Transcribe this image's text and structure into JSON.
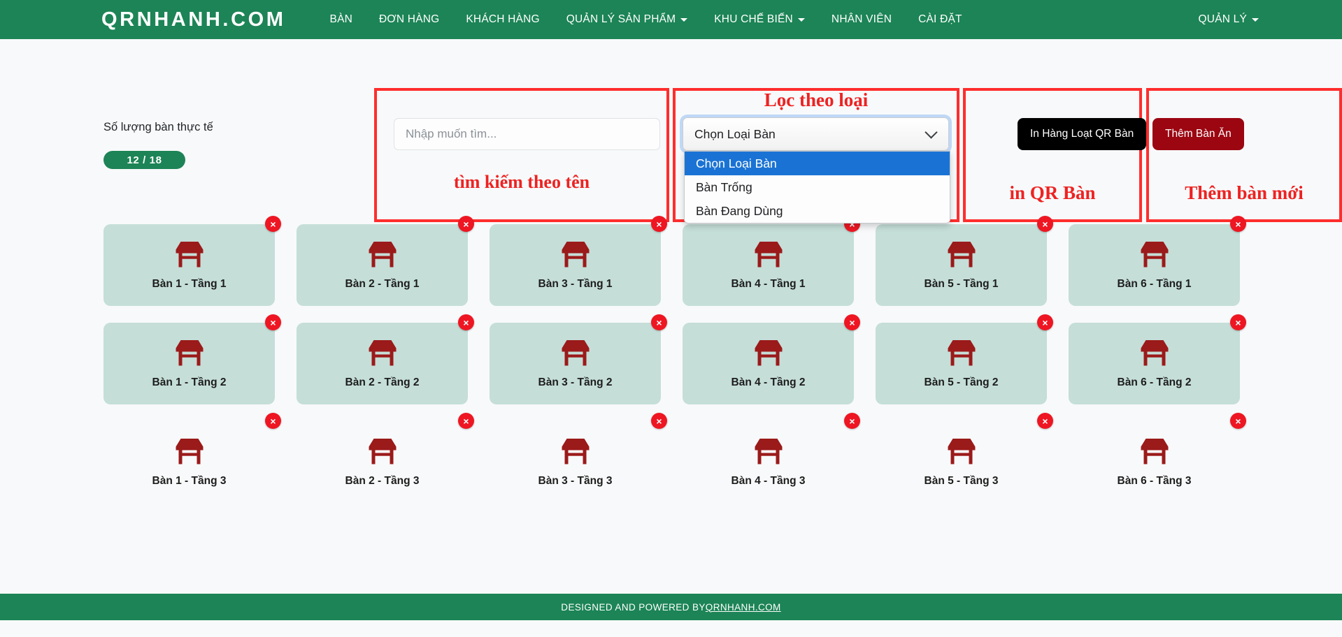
{
  "navbar": {
    "brand": "QRNHANH.COM",
    "links": [
      {
        "label": "BÀN",
        "caret": false
      },
      {
        "label": "ĐƠN HÀNG",
        "caret": false
      },
      {
        "label": "KHÁCH HÀNG",
        "caret": false
      },
      {
        "label": "QUẢN LÝ SẢN PHẨM",
        "caret": true
      },
      {
        "label": "KHU CHẾ BIẾN",
        "caret": true
      },
      {
        "label": "NHÂN VIÊN",
        "caret": false
      },
      {
        "label": "CÀI ĐẶT",
        "caret": false
      }
    ],
    "account": {
      "label": "QUẢN LÝ",
      "caret": true
    }
  },
  "summary": {
    "label": "Số lượng bàn thực tế",
    "badge": "12 / 18"
  },
  "search": {
    "placeholder": "Nhập muốn tìm...",
    "value": ""
  },
  "filter": {
    "selected": "Chọn Loại Bàn",
    "options": [
      "Chọn Loại Bàn",
      "Bàn Trống",
      "Bàn Đang Dùng"
    ]
  },
  "actions": {
    "print_qr": "In Hàng Loạt QR Bàn",
    "add_table": "Thêm Bàn Ăn"
  },
  "annotations": [
    {
      "label": "tìm kiếm theo tên"
    },
    {
      "label": "Lọc theo loại"
    },
    {
      "label": "in QR Bàn"
    },
    {
      "label": "Thêm bàn mới"
    }
  ],
  "tables": {
    "rows": [
      {
        "filled": true,
        "cells": [
          {
            "name": "Bàn 1 - Tầng 1"
          },
          {
            "name": "Bàn 2 - Tầng 1"
          },
          {
            "name": "Bàn 3 - Tầng 1"
          },
          {
            "name": "Bàn 4 - Tầng 1"
          },
          {
            "name": "Bàn 5 - Tầng 1"
          },
          {
            "name": "Bàn 6 - Tầng 1"
          }
        ]
      },
      {
        "filled": true,
        "cells": [
          {
            "name": "Bàn 1 - Tầng 2"
          },
          {
            "name": "Bàn 2 - Tầng 2"
          },
          {
            "name": "Bàn 3 - Tầng 2"
          },
          {
            "name": "Bàn 4 - Tầng 2"
          },
          {
            "name": "Bàn 5 - Tầng 2"
          },
          {
            "name": "Bàn 6 - Tầng 2"
          }
        ]
      },
      {
        "filled": false,
        "cells": [
          {
            "name": "Bàn 1 - Tầng 3"
          },
          {
            "name": "Bàn 2 - Tầng 3"
          },
          {
            "name": "Bàn 3 - Tầng 3"
          },
          {
            "name": "Bàn 4 - Tầng 3"
          },
          {
            "name": "Bàn 5 - Tầng 3"
          },
          {
            "name": "Bàn 6 - Tầng 3"
          }
        ]
      }
    ],
    "delete_icon": "×"
  },
  "footer": {
    "text": "DESIGNED AND POWERED BY ",
    "link": "QRNHANH.COM"
  },
  "colors": {
    "brand_green": "#1c8456",
    "accent_red": "#ee1622",
    "card_teal": "#c5ded8",
    "table_icon": "#9b1a1a",
    "dark_red_btn": "#9b0611",
    "select_highlight": "#1a73d4"
  }
}
